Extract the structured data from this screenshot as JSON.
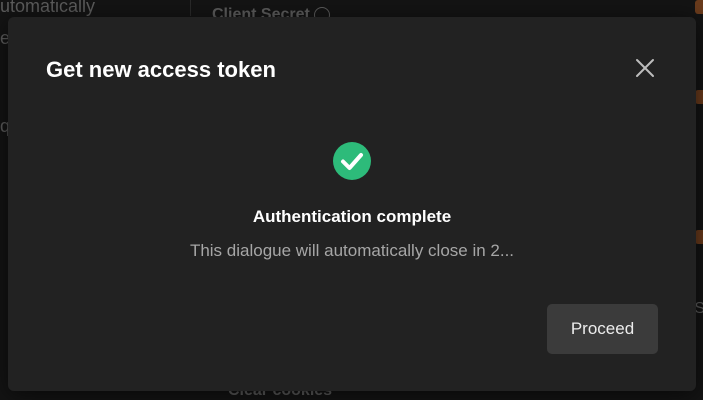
{
  "background": {
    "left_text_1": "utomatically",
    "left_text_2": "e",
    "left_text_3": "q",
    "top_label": "Client Secret",
    "bottom_action": "Clear cookies",
    "right_text": "S"
  },
  "dialog": {
    "title": "Get new access token",
    "close_icon": "close-icon",
    "status": {
      "icon": "check-circle-icon",
      "icon_color": "#2dbb7a",
      "title": "Authentication complete",
      "message": "This dialogue will automatically close in 2..."
    },
    "proceed_label": "Proceed"
  },
  "colors": {
    "dialog_bg": "#222222",
    "button_bg": "#3b3b3b",
    "accent_orange": "#6a3b1c"
  }
}
